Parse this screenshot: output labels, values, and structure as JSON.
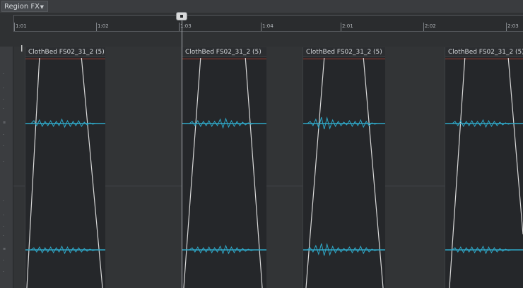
{
  "toolbar": {
    "region_fx_label": "Region FX",
    "dropdown_icon": "chevron-down-icon"
  },
  "ruler": {
    "ticks": [
      "1:01",
      "1:02",
      "1:03",
      "1:04",
      "2:01",
      "2:02",
      "2:03"
    ]
  },
  "clips": [
    {
      "name": "ClothBed FS02_31_2 (5)"
    },
    {
      "name": "ClothBed FS02_31_2 (5)"
    },
    {
      "name": "ClothBed FS02_31_2 (5)"
    },
    {
      "name": "ClothBed FS02_31_2 (5)"
    }
  ],
  "colors": {
    "waveform": "#2fa8c8",
    "fade_line": "#d9d9d9",
    "clip_red_line": "#a03a2c",
    "background": "#2f3133"
  }
}
